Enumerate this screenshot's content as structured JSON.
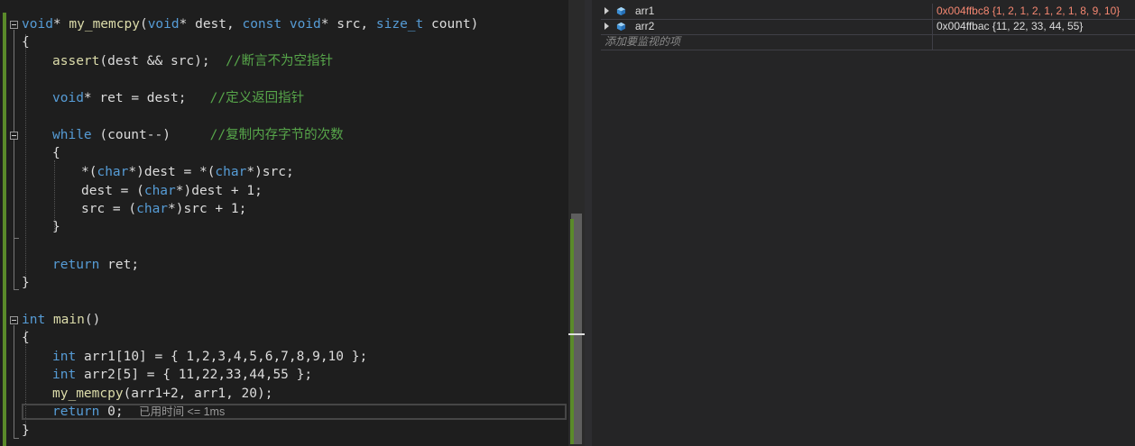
{
  "code": {
    "lines": {
      "l0": [
        "void",
        "* ",
        "my_memcpy",
        "(",
        "void",
        "* dest, ",
        "const",
        " ",
        "void",
        "* src, ",
        "size_t",
        " count)"
      ],
      "l1": "{",
      "l2": [
        "assert",
        "(dest && src);  ",
        "//断言不为空指针"
      ],
      "l4": [
        "void",
        "* ",
        "ret",
        " = dest;   ",
        "//定义返回指针"
      ],
      "l6": [
        "while",
        " (count--)     ",
        "//复制内存字节的次数"
      ],
      "l7": "{",
      "l8": [
        "*(",
        "char",
        "*)dest = *(",
        "char",
        "*)src;"
      ],
      "l9": [
        "dest = (",
        "char",
        "*)dest + 1;"
      ],
      "l10": [
        "src = (",
        "char",
        "*)src + 1;"
      ],
      "l11": "}",
      "l13": [
        "return",
        " ",
        "ret",
        ";"
      ],
      "l14": "}",
      "l16": [
        "int",
        " ",
        "main",
        "()"
      ],
      "l17": "{",
      "l19": [
        "int",
        " ",
        "arr1",
        "[10] = { 1,2,3,4,5,6,7,8,9,10 };"
      ],
      "l20": [
        "int",
        " ",
        "arr2",
        "[5] = { 11,22,33,44,55 };"
      ],
      "l21": [
        "my_memcpy",
        "(arr1+2, arr1, 20);"
      ],
      "l22": [
        "return",
        " 0;"
      ],
      "l23": "}"
    },
    "perf_tip": "已用时间 <= 1ms"
  },
  "watch": {
    "rows": [
      {
        "name": "arr1",
        "value": "0x004ffbc8 {1, 2, 1, 2, 1, 2, 1, 8, 9, 10}",
        "value_color": "#f48771"
      },
      {
        "name": "arr2",
        "value": "0x004ffbac {11, 22, 33, 44, 55}",
        "value_color": "#dcdcdc"
      }
    ],
    "add_placeholder": "添加要监视的项"
  },
  "colors": {
    "keyword": "#569cd6",
    "function": "#dcdcaa",
    "comment": "#57a64a",
    "changed_value": "#f48771",
    "change_bar": "#5a8a2a"
  },
  "icons": {
    "expand": "chevron-right-icon",
    "variable": "variable-cube-icon",
    "fold": "collapse-minus-icon"
  }
}
